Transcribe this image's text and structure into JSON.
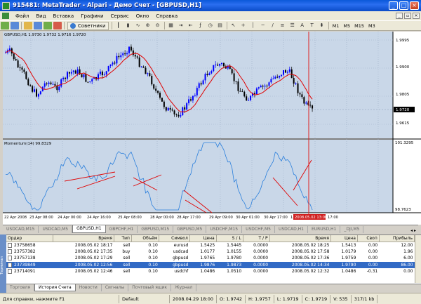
{
  "window": {
    "title": "915481: MetaTrader - Alpari - Демо Счет - [GBPUSD,H1]"
  },
  "menu": [
    "Файл",
    "Вид",
    "Вставка",
    "Графики",
    "Сервис",
    "Окно",
    "Справка"
  ],
  "toolbar": {
    "advisors_label": "Советники",
    "timeframes": [
      "M1",
      "M5",
      "M15",
      "M3"
    ]
  },
  "chart": {
    "info": "GBPUSD,H1  1.9730 1.9732 1.9716 1.9720",
    "momentum_label": "Momentum(14) 99.8329",
    "price_ticks": [
      "1.9995",
      "1.9900",
      "1.9805",
      "1.9720",
      "1.9615"
    ],
    "current_price": "1.9720",
    "momentum_ticks": [
      "101.3295",
      "98.7623"
    ],
    "time_ticks": [
      "22 Apr 2008",
      "23 Apr 08:00",
      "24 Apr 00:00",
      "24 Apr 16:00",
      "25 Apr 08:00",
      "28 Apr 00:00",
      "28 Apr 17:00",
      "29 Apr 09:00",
      "30 Apr 01:00",
      "30 Apr 17:00",
      "1 May 09:00"
    ],
    "cursor_time": "2008.05.02 13:00",
    "after_cursor_time": "17:00",
    "colors": {
      "bullish_bar": "#0000ff",
      "bearish_bar": "#000000",
      "ma_line": "#e00000",
      "momentum_line": "#2a7fdc",
      "cursor": "#e02020"
    }
  },
  "chart_tabs": [
    "USDCAD,M15",
    "USDCAD,M5",
    "GBPUSD,H1",
    "GBPCHF,H1",
    "GBPUSD,M15",
    "GBPUSD,M5",
    "USDCHF,M15",
    "USDCHF,M5",
    "USDCAD,H1",
    "EURUSD,H1",
    "_DJI,M5"
  ],
  "chart_tabs_active": 2,
  "orders": {
    "columns": [
      "Ордер",
      "Время",
      "Тип",
      "Объём",
      "Символ",
      "Цена",
      "S / L",
      "T / P",
      "Время",
      "Цена",
      "Своп",
      "Прибыль"
    ],
    "rows": [
      [
        "23758658",
        "2008.05.02 18:17",
        "sell",
        "0.10",
        "eurusd",
        "1.5425",
        "1.5445",
        "0.0000",
        "2008.05.02 18:25",
        "1.5413",
        "0.00",
        "12.00"
      ],
      [
        "23757382",
        "2008.05.02 17:35",
        "buy",
        "0.10",
        "usdcad",
        "1.0177",
        "1.0155",
        "0.0000",
        "2008.05.02 17:58",
        "1.0179",
        "0.00",
        "1.96"
      ],
      [
        "23757138",
        "2008.05.02 17:29",
        "sell",
        "0.10",
        "gbpusd",
        "1.9765",
        "1.9780",
        "0.0000",
        "2008.05.02 17:36",
        "1.9759",
        "0.00",
        "6.00"
      ],
      [
        "23739849",
        "2008.05.02 12:56",
        "sell",
        "0.10",
        "gbpusd",
        "1.9876",
        "1.9873",
        "0.0000",
        "2008.05.02 14:34",
        "1.9790",
        "0.00",
        "86.00"
      ],
      [
        "23714091",
        "2008.05.02 12:46",
        "sell",
        "0.10",
        "usdchf",
        "1.0486",
        "1.0510",
        "0.0000",
        "2008.05.02 12:32",
        "1.0486",
        "-0.31",
        "0.00"
      ]
    ],
    "selected_row": 3
  },
  "terminal_tabs": [
    "Торговля",
    "История Счета",
    "Новости",
    "Сигналы",
    "Почтовый ящик",
    "Журнал"
  ],
  "terminal_tabs_active": 1,
  "terminal_side_label": "Терминал",
  "status": {
    "help": "Для справки, нажмите F1",
    "profile": "Default",
    "datetime": "2008.04.29 18:00",
    "open": "O: 1.9742",
    "high": "H: 1.9757",
    "low": "L: 1.9719",
    "close": "C: 1.9719",
    "volume": "V: 535",
    "traffic": "317/1 kb"
  }
}
